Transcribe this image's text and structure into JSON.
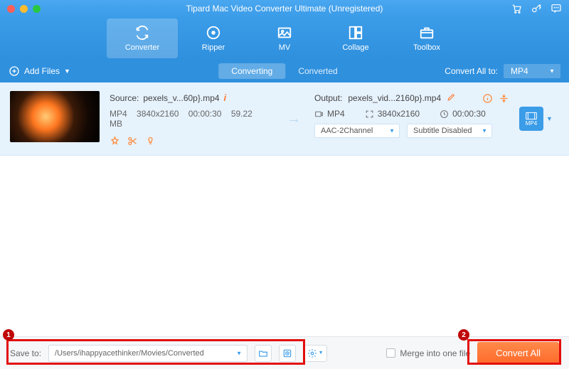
{
  "window": {
    "title": "Tipard Mac Video Converter Ultimate (Unregistered)"
  },
  "nav": {
    "items": [
      {
        "label": "Converter",
        "icon": "refresh"
      },
      {
        "label": "Ripper",
        "icon": "disc"
      },
      {
        "label": "MV",
        "icon": "image"
      },
      {
        "label": "Collage",
        "icon": "collage"
      },
      {
        "label": "Toolbox",
        "icon": "toolbox"
      }
    ],
    "active": 0
  },
  "toolbar": {
    "add_files": "Add Files",
    "tabs": {
      "converting": "Converting",
      "converted": "Converted"
    },
    "convert_all_to": "Convert All to:",
    "format": "MP4"
  },
  "item": {
    "source_label": "Source:",
    "source_name": "pexels_v...60p}.mp4",
    "meta": {
      "format": "MP4",
      "resolution": "3840x2160",
      "duration": "00:00:30",
      "size": "59.22 MB"
    },
    "output_label": "Output:",
    "output_name": "pexels_vid...2160p}.mp4",
    "out_meta": {
      "format": "MP4",
      "resolution": "3840x2160",
      "duration": "00:00:30"
    },
    "audio_select": "AAC-2Channel",
    "subtitle_select": "Subtitle Disabled",
    "format_badge": "MP4"
  },
  "bottom": {
    "save_to_label": "Save to:",
    "save_path": "/Users/ihappyacethinker/Movies/Converted",
    "merge_label": "Merge into one file",
    "convert_all": "Convert All"
  },
  "annotations": {
    "b1": "1",
    "b2": "2"
  }
}
